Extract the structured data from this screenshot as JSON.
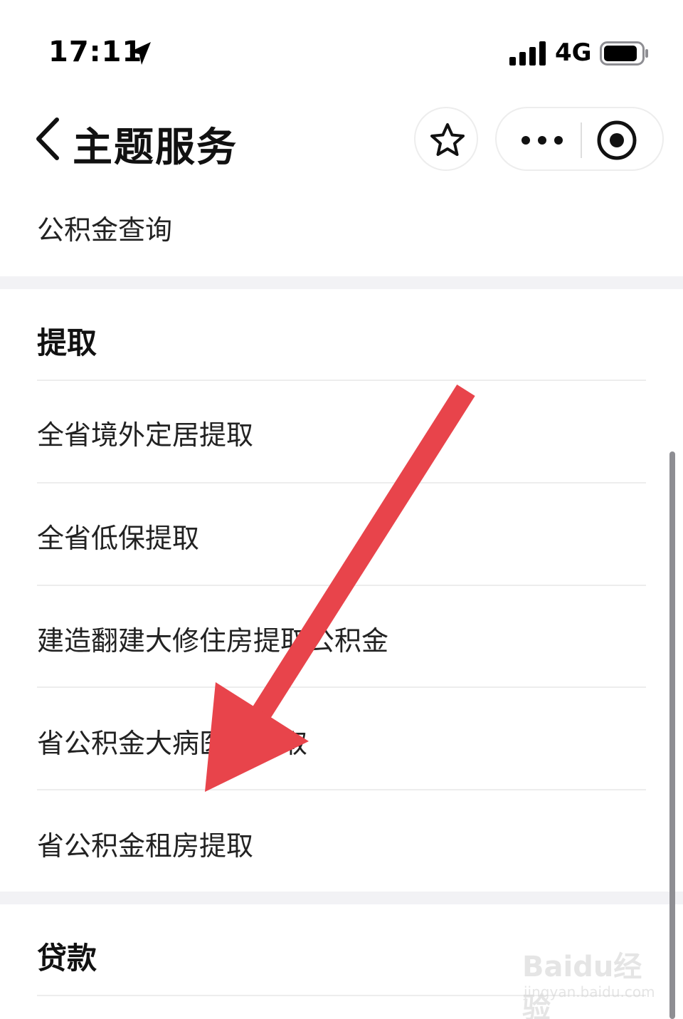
{
  "status_bar": {
    "time": "17:11",
    "network": "4G",
    "icons": [
      "location-arrow-icon",
      "signal-bars-icon",
      "battery-icon"
    ]
  },
  "nav": {
    "title": "主题服务",
    "icons": [
      "back-chevron-icon",
      "star-icon",
      "more-dots-icon",
      "close-miniapp-icon"
    ]
  },
  "top_item": {
    "label": "公积金查询"
  },
  "sections": [
    {
      "title": "提取",
      "items": [
        "全省境外定居提取",
        "全省低保提取",
        "建造翻建大修住房提取公积金",
        "省公积金大病医疗提取",
        "省公积金租房提取"
      ]
    },
    {
      "title": "贷款",
      "items": []
    }
  ],
  "annotation": {
    "color": "#e8444b"
  },
  "watermark": {
    "logo": "Baidu经验",
    "url": "jingyan.baidu.com"
  }
}
